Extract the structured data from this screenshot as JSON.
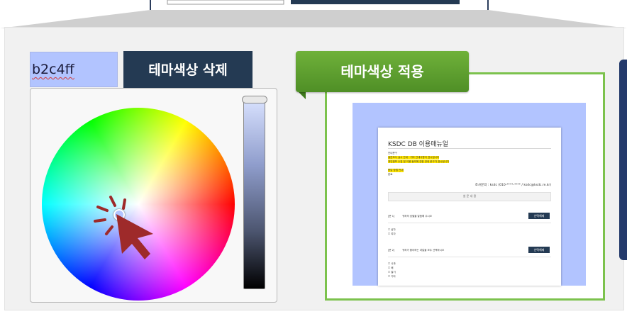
{
  "color_picker": {
    "hex_value": "b2c4ff",
    "delete_button_label": "테마색상 삭제",
    "selected_color": "#b2c4ff"
  },
  "theme": {
    "apply_label": "테마색상 적용",
    "accent_green": "#5fa030",
    "navy": "#243a53"
  },
  "manual_preview": {
    "title": "KSDC DB 이용매뉴얼",
    "lines": [
      "안내문구",
      "설문조사 실시 안내 · 기타 안내사항이 표시됩니다",
      "개인정보 수집 및 이용 동의에 관한 안내 문구가 표시됩니다",
      "응답 방법 안내",
      "완료"
    ],
    "contact": "조사문의 : ksdc (010-****-**** / ksdc@ksdc.re.kr)",
    "section_header": "설 문 내 용",
    "questions": [
      {
        "num": "[문 1]",
        "text": "귀하의 성별을 말씀해 주시오",
        "button": "선택해제",
        "options": [
          "남자",
          "여자"
        ]
      },
      {
        "num": "[문 2]",
        "text": "귀하가 좋아하는 과일을 모두 선택하시오",
        "button": "선택해제",
        "options": [
          "사과",
          "배",
          "딸기",
          "기타"
        ]
      }
    ]
  },
  "icons": {
    "cursor": "click-cursor-icon"
  }
}
